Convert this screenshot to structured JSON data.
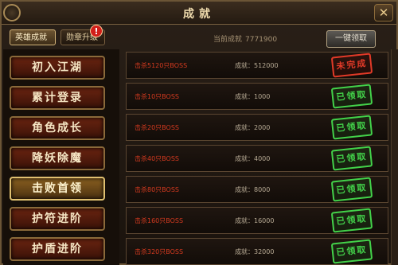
{
  "window": {
    "title": "成就",
    "close_glyph": "✕"
  },
  "tabs": [
    {
      "label": "英雄成就",
      "active": true
    },
    {
      "label": "勋章升级",
      "active": false,
      "badge": "!"
    }
  ],
  "points": {
    "label": "当前成就",
    "value": "7771900"
  },
  "claim_all_label": "一键领取",
  "sidebar": [
    {
      "label": "初入江湖"
    },
    {
      "label": "累计登录"
    },
    {
      "label": "角色成长"
    },
    {
      "label": "降妖除魔"
    },
    {
      "label": "击败首领",
      "active": true
    },
    {
      "label": "护符进阶"
    },
    {
      "label": "护盾进阶"
    }
  ],
  "achievements": [
    {
      "name": "击杀5120只BOSS",
      "points_label": "成就",
      "points": "512000",
      "status": "未完成",
      "status_type": "undone"
    },
    {
      "name": "击杀10只BOSS",
      "points_label": "成就",
      "points": "1000",
      "status": "已领取",
      "status_type": "done"
    },
    {
      "name": "击杀20只BOSS",
      "points_label": "成就",
      "points": "2000",
      "status": "已领取",
      "status_type": "done"
    },
    {
      "name": "击杀40只BOSS",
      "points_label": "成就",
      "points": "4000",
      "status": "已领取",
      "status_type": "done"
    },
    {
      "name": "击杀80只BOSS",
      "points_label": "成就",
      "points": "8000",
      "status": "已领取",
      "status_type": "done"
    },
    {
      "name": "击杀160只BOSS",
      "points_label": "成就",
      "points": "16000",
      "status": "已领取",
      "status_type": "done"
    },
    {
      "name": "击杀320只BOSS",
      "points_label": "成就",
      "points": "32000",
      "status": "已领取",
      "status_type": "done"
    }
  ],
  "colors": {
    "done_stamp": "#43d24a",
    "undone_stamp": "#e23a28",
    "achievement_name": "#d63a1f"
  }
}
